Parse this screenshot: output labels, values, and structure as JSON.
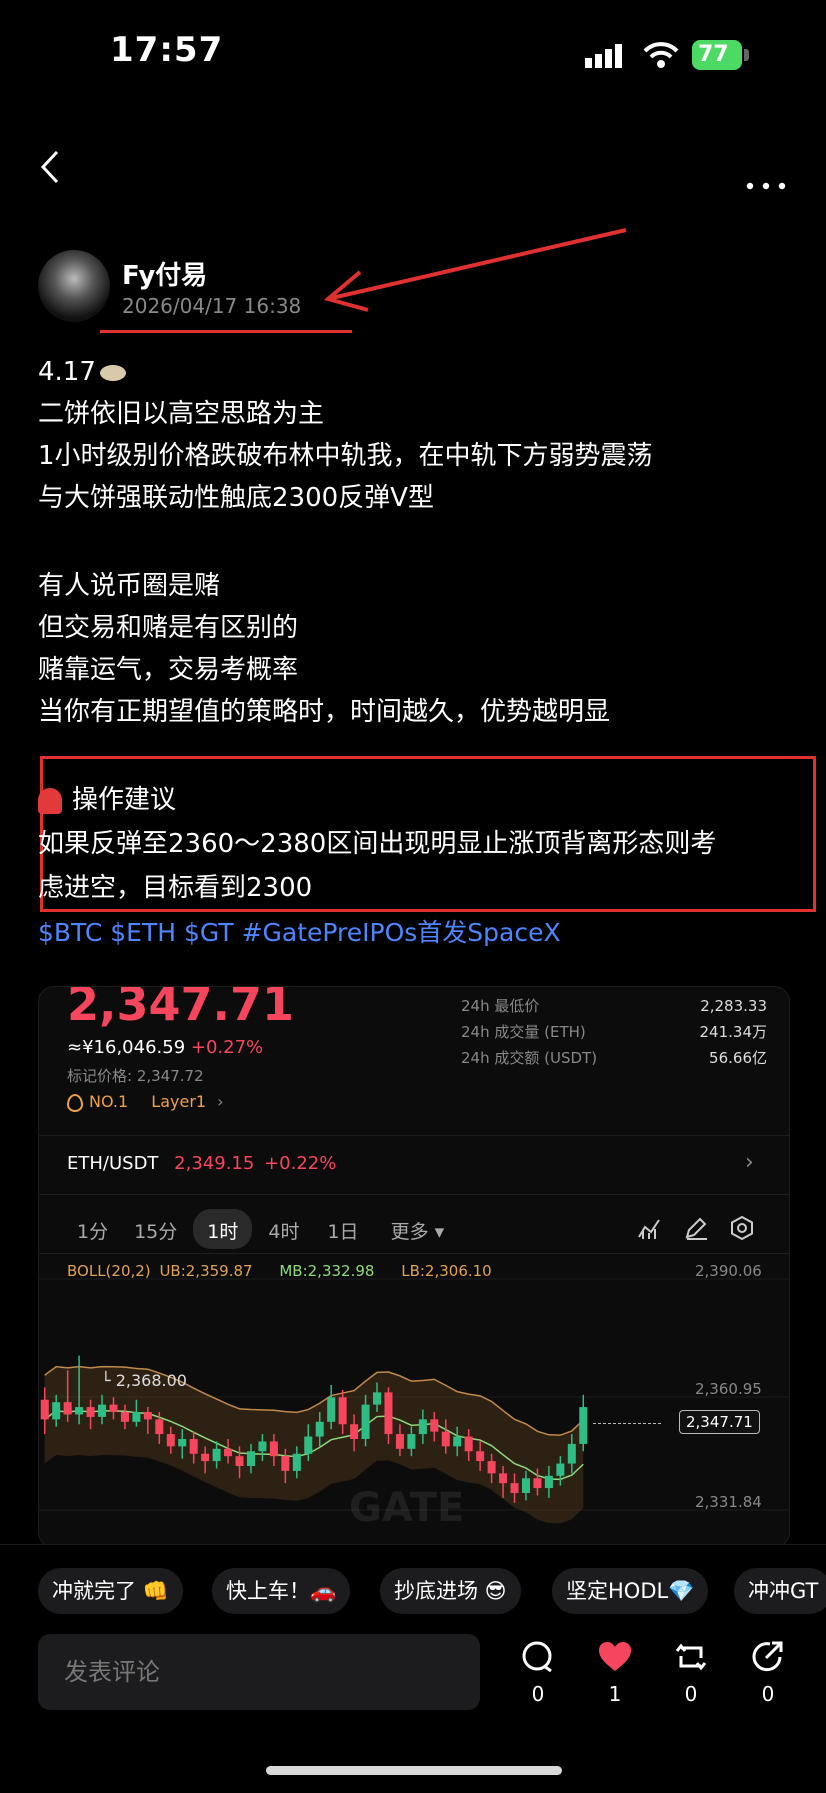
{
  "status_bar": {
    "time": "17:57",
    "battery": "77"
  },
  "author": {
    "name": "Fy付易",
    "time": "2026/04/17 16:38"
  },
  "post": {
    "lines": [
      "4.17",
      "二饼依旧以高空思路为主",
      "1小时级别价格跌破布林中轨我，在中轨下方弱势震荡",
      "与大饼强联动性触底2300反弹V型",
      "",
      "有人说币圈是赌",
      "但交易和赌是有区别的",
      "赌靠运气，交易考概率",
      "当你有正期望值的策略时，时间越久，优势越明显"
    ],
    "advice_title": "操作建议",
    "advice_line1": "如果反弹至2360～2380区间出现明显止涨顶背离形态则考",
    "advice_line2": "虑进空，目标看到2300",
    "tags": "$BTC $ETH $GT #GatePreIPOs首发SpaceX"
  },
  "chart_card": {
    "price": "2,347.71",
    "cny": "≈¥16,046.59",
    "change": "+0.27%",
    "mark_price": "标记价格: 2,347.72",
    "rank": "NO.1",
    "category": "Layer1",
    "stats": [
      {
        "label": "24h 最低价",
        "value": "2,283.33"
      },
      {
        "label": "24h 成交量 (ETH)",
        "value": "241.34万"
      },
      {
        "label": "24h 成交额 (USDT)",
        "value": "56.66亿"
      }
    ],
    "pair": "ETH/USDT",
    "pair_price": "2,349.15",
    "pair_change": "+0.22%",
    "timeframes": [
      "1分",
      "15分",
      "1时",
      "4时",
      "1日",
      "更多"
    ],
    "active_timeframe": "1时",
    "boll_label": "BOLL(20,2)",
    "ub": "UB:2,359.87",
    "mb": "MB:2,332.98",
    "lb": "LB:2,306.10",
    "high_marker": "2,368.00",
    "last_price": "2,347.71",
    "watermark": "GATE"
  },
  "chart_data": {
    "type": "candlestick",
    "y_ticks": [
      "2,390.06",
      "2,360.95",
      "2,331.84"
    ],
    "ylim": [
      2290,
      2400
    ],
    "candles": [
      [
        2350,
        2342,
        2355,
        2336
      ],
      [
        2342,
        2349,
        2352,
        2339
      ],
      [
        2349,
        2344,
        2362,
        2341
      ],
      [
        2344,
        2347,
        2368,
        2340
      ],
      [
        2347,
        2343,
        2350,
        2338
      ],
      [
        2343,
        2348,
        2352,
        2340
      ],
      [
        2348,
        2345,
        2351,
        2342
      ],
      [
        2345,
        2341,
        2348,
        2338
      ],
      [
        2341,
        2345,
        2350,
        2339
      ],
      [
        2345,
        2342,
        2347,
        2336
      ],
      [
        2342,
        2336,
        2345,
        2332
      ],
      [
        2336,
        2331,
        2339,
        2328
      ],
      [
        2331,
        2334,
        2338,
        2326
      ],
      [
        2334,
        2328,
        2337,
        2324
      ],
      [
        2328,
        2325,
        2331,
        2320
      ],
      [
        2325,
        2330,
        2333,
        2322
      ],
      [
        2330,
        2327,
        2334,
        2324
      ],
      [
        2327,
        2323,
        2331,
        2318
      ],
      [
        2323,
        2329,
        2332,
        2320
      ],
      [
        2329,
        2333,
        2336,
        2325
      ],
      [
        2333,
        2327,
        2336,
        2323
      ],
      [
        2327,
        2321,
        2330,
        2316
      ],
      [
        2321,
        2328,
        2331,
        2318
      ],
      [
        2328,
        2335,
        2340,
        2325
      ],
      [
        2335,
        2341,
        2345,
        2331
      ],
      [
        2341,
        2351,
        2356,
        2338
      ],
      [
        2351,
        2340,
        2354,
        2336
      ],
      [
        2340,
        2334,
        2344,
        2329
      ],
      [
        2334,
        2348,
        2352,
        2331
      ],
      [
        2348,
        2353,
        2357,
        2345
      ],
      [
        2353,
        2336,
        2355,
        2332
      ],
      [
        2336,
        2330,
        2340,
        2327
      ],
      [
        2330,
        2336,
        2339,
        2327
      ],
      [
        2336,
        2342,
        2346,
        2332
      ],
      [
        2342,
        2337,
        2345,
        2333
      ],
      [
        2337,
        2331,
        2342,
        2328
      ],
      [
        2331,
        2335,
        2339,
        2327
      ],
      [
        2335,
        2329,
        2338,
        2325
      ],
      [
        2329,
        2325,
        2333,
        2321
      ],
      [
        2325,
        2320,
        2328,
        2316
      ],
      [
        2320,
        2316,
        2323,
        2310
      ],
      [
        2316,
        2312,
        2320,
        2308
      ],
      [
        2312,
        2318,
        2321,
        2309
      ],
      [
        2318,
        2314,
        2322,
        2311
      ],
      [
        2314,
        2319,
        2323,
        2310
      ],
      [
        2319,
        2324,
        2327,
        2315
      ],
      [
        2324,
        2332,
        2336,
        2320
      ],
      [
        2332,
        2347,
        2352,
        2329
      ]
    ]
  },
  "quick_replies": [
    "冲就完了 👊",
    "快上车！🚗",
    "抄底进场 😎",
    "坚定HODL💎",
    "冲冲GT"
  ],
  "comment_placeholder": "发表评论",
  "actions": {
    "comments": "0",
    "likes": "1",
    "reposts": "0",
    "shares": "0"
  },
  "colors": {
    "up": "#2ebd85",
    "down": "#f6465d",
    "accent": "#4e86ff",
    "annotation": "#e03030"
  }
}
